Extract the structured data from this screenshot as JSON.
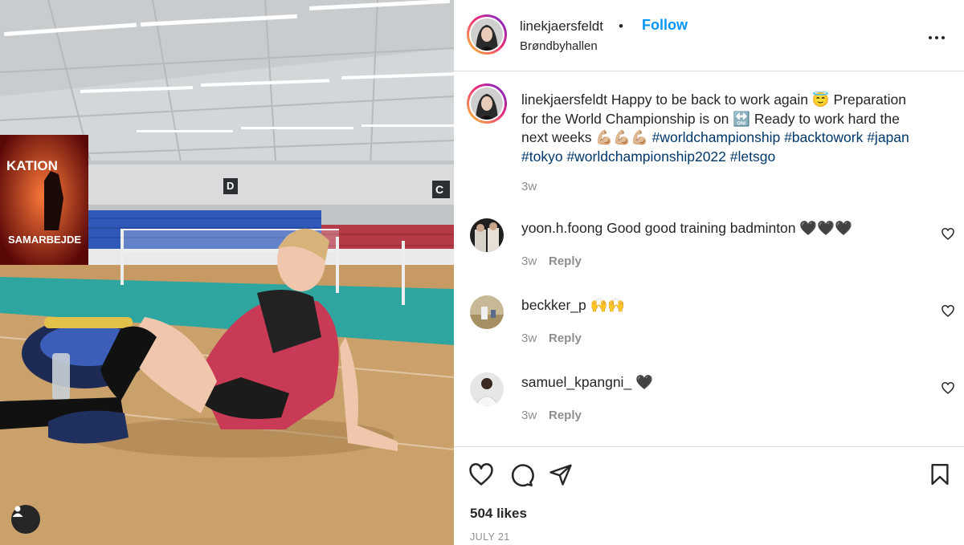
{
  "post": {
    "username": "linekjaersfeldt",
    "separator": "•",
    "follow_label": "Follow",
    "location": "Brøndbyhallen",
    "more_icon": "more-options-icon"
  },
  "photo": {
    "banner_top": "KATION",
    "banner_bottom": "SAMARBEJDE",
    "sign_d": "D",
    "sign_c": "C",
    "user_tag_icon": "user-tag-icon"
  },
  "caption": {
    "username": "linekjaersfeldt",
    "text_1": "Happy to be back to work again 😇 Preparation for the World Championship is on 🔛 Ready to work hard the next weeks 💪🏼💪🏼💪🏼",
    "hashtags": [
      "#worldchampionship",
      "#backtowork",
      "#japan",
      "#tokyo",
      "#worldchampionship2022",
      "#letsgo"
    ],
    "time": "3w"
  },
  "comments": [
    {
      "username": "yoon.h.foong",
      "text": "Good good training badminton 🖤🖤🖤",
      "time": "3w",
      "reply_label": "Reply"
    },
    {
      "username": "beckker_p",
      "text": "🙌🙌",
      "time": "3w",
      "reply_label": "Reply"
    },
    {
      "username": "samuel_kpangni_",
      "text": "🖤",
      "time": "3w",
      "reply_label": "Reply"
    }
  ],
  "actions": {
    "like_icon": "heart-icon",
    "comment_icon": "comment-icon",
    "share_icon": "share-icon",
    "save_icon": "bookmark-icon"
  },
  "likes": "504 likes",
  "date": "JULY 21",
  "colors": {
    "accent": "#0095f6",
    "hashtag": "#00376b",
    "muted": "#8e8e8e",
    "text": "#262626"
  }
}
